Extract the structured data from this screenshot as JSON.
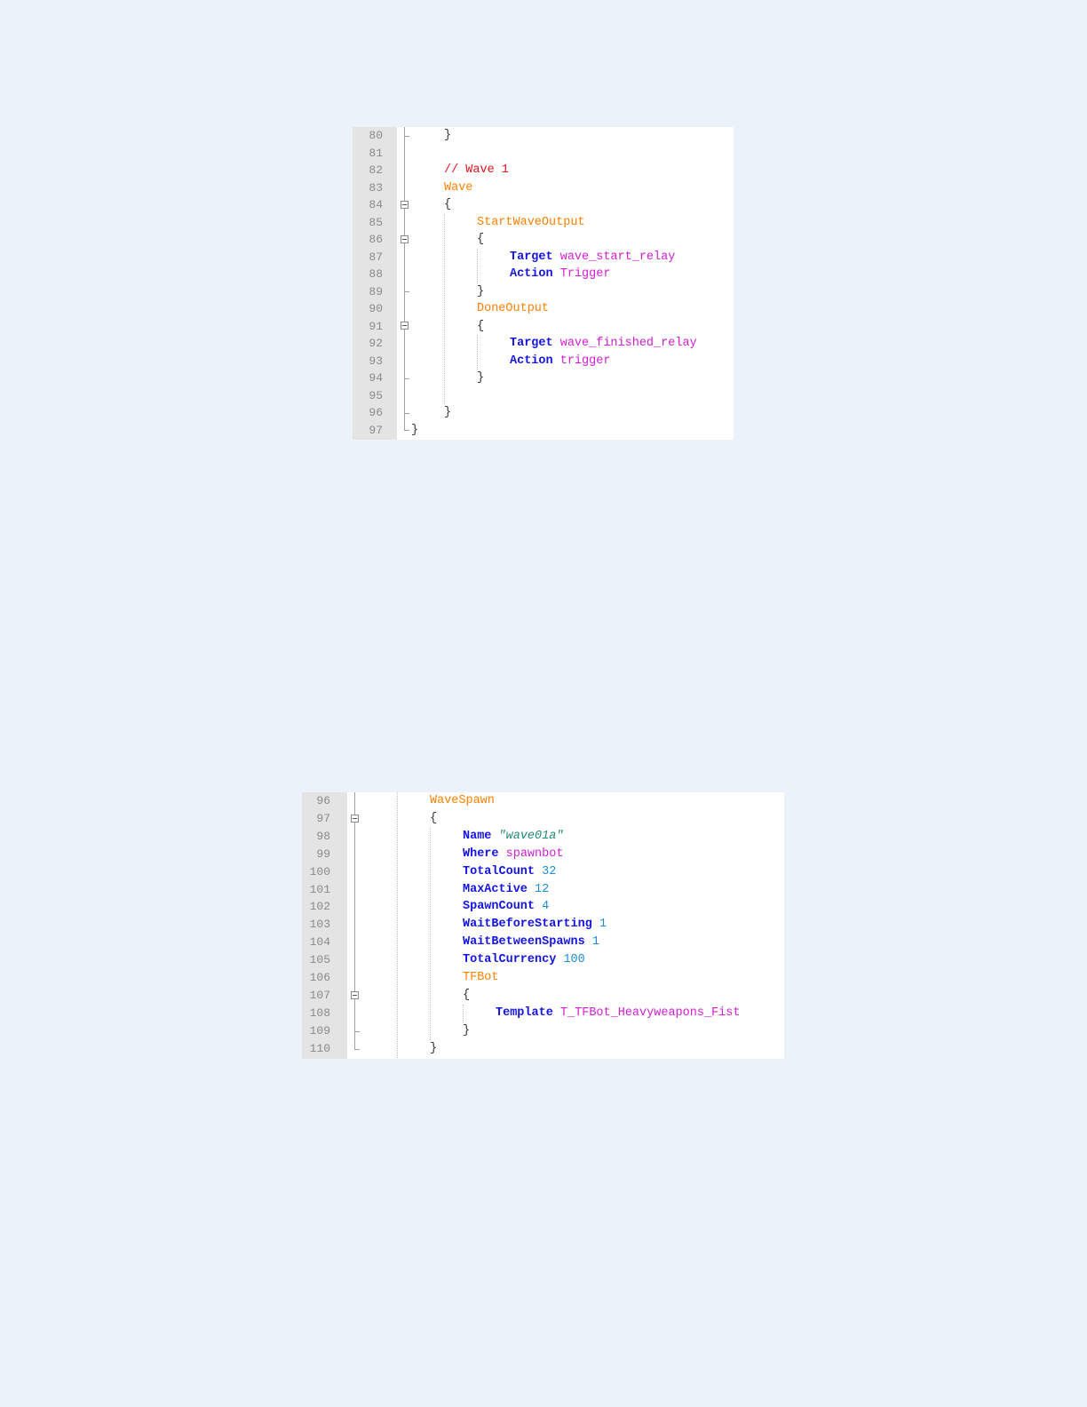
{
  "snippets": [
    {
      "lines": [
        {
          "num": "80",
          "indent": 1,
          "tokens": [
            {
              "t": "}",
              "c": "brace"
            }
          ]
        },
        {
          "num": "81",
          "indent": 0,
          "tokens": []
        },
        {
          "num": "82",
          "indent": 1,
          "tokens": [
            {
              "t": "// Wave 1",
              "c": "comment"
            }
          ]
        },
        {
          "num": "83",
          "indent": 1,
          "tokens": [
            {
              "t": "Wave",
              "c": "section"
            }
          ]
        },
        {
          "num": "84",
          "indent": 1,
          "tokens": [
            {
              "t": "{",
              "c": "brace"
            }
          ]
        },
        {
          "num": "85",
          "indent": 2,
          "tokens": [
            {
              "t": "StartWaveOutput",
              "c": "section"
            }
          ]
        },
        {
          "num": "86",
          "indent": 2,
          "tokens": [
            {
              "t": "{",
              "c": "brace"
            }
          ]
        },
        {
          "num": "87",
          "indent": 3,
          "tokens": [
            {
              "t": "Target",
              "c": "key"
            },
            {
              "t": " ",
              "c": ""
            },
            {
              "t": "wave_start_relay",
              "c": "val"
            }
          ]
        },
        {
          "num": "88",
          "indent": 3,
          "tokens": [
            {
              "t": "Action",
              "c": "key"
            },
            {
              "t": " ",
              "c": ""
            },
            {
              "t": "Trigger",
              "c": "val"
            }
          ]
        },
        {
          "num": "89",
          "indent": 2,
          "tokens": [
            {
              "t": "}",
              "c": "brace"
            }
          ]
        },
        {
          "num": "90",
          "indent": 2,
          "tokens": [
            {
              "t": "DoneOutput",
              "c": "section"
            }
          ]
        },
        {
          "num": "91",
          "indent": 2,
          "tokens": [
            {
              "t": "{",
              "c": "brace"
            }
          ]
        },
        {
          "num": "92",
          "indent": 3,
          "tokens": [
            {
              "t": "Target",
              "c": "key"
            },
            {
              "t": " ",
              "c": ""
            },
            {
              "t": "wave_finished_relay",
              "c": "val"
            }
          ]
        },
        {
          "num": "93",
          "indent": 3,
          "tokens": [
            {
              "t": "Action",
              "c": "key"
            },
            {
              "t": " ",
              "c": ""
            },
            {
              "t": "trigger",
              "c": "val"
            }
          ]
        },
        {
          "num": "94",
          "indent": 2,
          "tokens": [
            {
              "t": "}",
              "c": "brace"
            }
          ]
        },
        {
          "num": "95",
          "indent": 0,
          "tokens": []
        },
        {
          "num": "96",
          "indent": 1,
          "tokens": [
            {
              "t": "}",
              "c": "brace"
            }
          ]
        },
        {
          "num": "97",
          "indent": 0,
          "tokens": [
            {
              "t": "}",
              "c": "brace"
            }
          ]
        }
      ]
    },
    {
      "lines": [
        {
          "num": "96",
          "indent": 2,
          "tokens": [
            {
              "t": "WaveSpawn",
              "c": "section"
            }
          ]
        },
        {
          "num": "97",
          "indent": 2,
          "tokens": [
            {
              "t": "{",
              "c": "brace"
            }
          ]
        },
        {
          "num": "98",
          "indent": 3,
          "tokens": [
            {
              "t": "Name",
              "c": "key"
            },
            {
              "t": " ",
              "c": ""
            },
            {
              "t": "\"wave01a\"",
              "c": "str"
            }
          ]
        },
        {
          "num": "99",
          "indent": 3,
          "tokens": [
            {
              "t": "Where",
              "c": "key"
            },
            {
              "t": " ",
              "c": ""
            },
            {
              "t": "spawnbot",
              "c": "val"
            }
          ]
        },
        {
          "num": "100",
          "indent": 3,
          "tokens": [
            {
              "t": "TotalCount",
              "c": "key"
            },
            {
              "t": " ",
              "c": ""
            },
            {
              "t": "32",
              "c": "num"
            }
          ]
        },
        {
          "num": "101",
          "indent": 3,
          "tokens": [
            {
              "t": "MaxActive",
              "c": "key"
            },
            {
              "t": " ",
              "c": ""
            },
            {
              "t": "12",
              "c": "num"
            }
          ]
        },
        {
          "num": "102",
          "indent": 3,
          "tokens": [
            {
              "t": "SpawnCount",
              "c": "key"
            },
            {
              "t": " ",
              "c": ""
            },
            {
              "t": "4",
              "c": "num"
            }
          ]
        },
        {
          "num": "103",
          "indent": 3,
          "tokens": [
            {
              "t": "WaitBeforeStarting",
              "c": "key"
            },
            {
              "t": " ",
              "c": ""
            },
            {
              "t": "1",
              "c": "num"
            }
          ]
        },
        {
          "num": "104",
          "indent": 3,
          "tokens": [
            {
              "t": "WaitBetweenSpawns",
              "c": "key"
            },
            {
              "t": " ",
              "c": ""
            },
            {
              "t": "1",
              "c": "num"
            }
          ]
        },
        {
          "num": "105",
          "indent": 3,
          "tokens": [
            {
              "t": "TotalCurrency",
              "c": "key"
            },
            {
              "t": " ",
              "c": ""
            },
            {
              "t": "100",
              "c": "num"
            }
          ]
        },
        {
          "num": "106",
          "indent": 3,
          "tokens": [
            {
              "t": "TFBot",
              "c": "section"
            }
          ]
        },
        {
          "num": "107",
          "indent": 3,
          "tokens": [
            {
              "t": "{",
              "c": "brace"
            }
          ]
        },
        {
          "num": "108",
          "indent": 4,
          "tokens": [
            {
              "t": "Template",
              "c": "key"
            },
            {
              "t": " ",
              "c": ""
            },
            {
              "t": "T_TFBot_Heavyweapons_Fist",
              "c": "val"
            }
          ]
        },
        {
          "num": "109",
          "indent": 3,
          "tokens": [
            {
              "t": "}",
              "c": "brace"
            }
          ]
        },
        {
          "num": "110",
          "indent": 2,
          "tokens": [
            {
              "t": "}",
              "c": "brace"
            }
          ]
        }
      ]
    }
  ]
}
